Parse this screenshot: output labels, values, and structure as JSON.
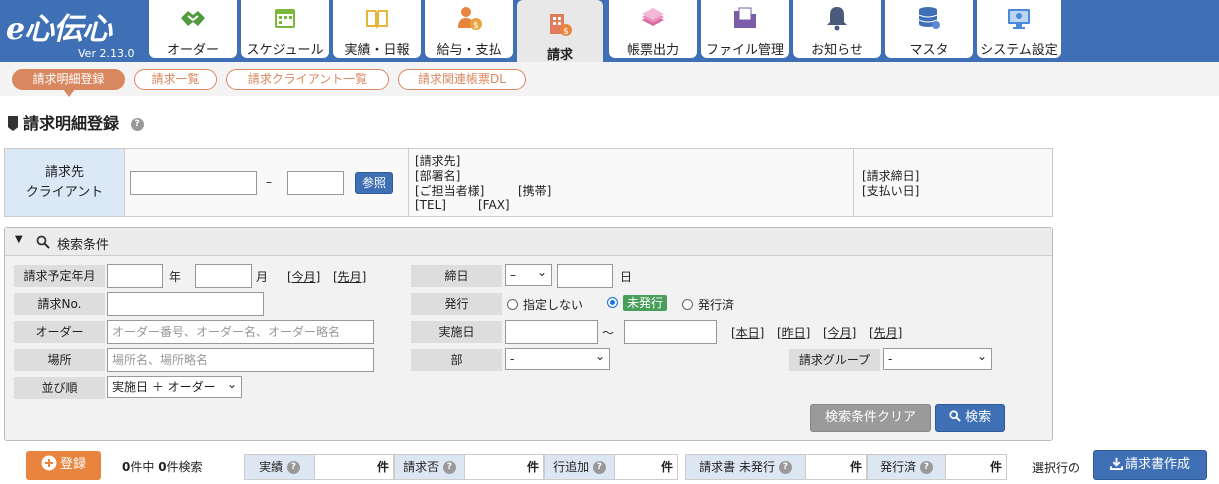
{
  "app": {
    "logo_text": "e心伝心",
    "version": "Ver 2.13.0"
  },
  "nav": {
    "tabs": [
      {
        "label": "オーダー",
        "icon": "handshake-icon"
      },
      {
        "label": "スケジュール",
        "icon": "calendar-icon"
      },
      {
        "label": "実績・日報",
        "icon": "book-icon"
      },
      {
        "label": "給与・支払",
        "icon": "payment-person-icon"
      },
      {
        "label": "請求",
        "icon": "billing-building-icon"
      },
      {
        "label": "帳票出力",
        "icon": "documents-icon"
      },
      {
        "label": "ファイル管理",
        "icon": "folder-icon"
      },
      {
        "label": "お知らせ",
        "icon": "bell-icon"
      },
      {
        "label": "マスタ",
        "icon": "database-icon"
      },
      {
        "label": "システム設定",
        "icon": "settings-monitor-icon"
      }
    ],
    "active": "請求"
  },
  "subnav": {
    "items": [
      "請求明細登録",
      "請求一覧",
      "請求クライアント一覧",
      "請求関連帳票DL"
    ],
    "active": "請求明細登録"
  },
  "page": {
    "title": "請求明細登録"
  },
  "client": {
    "header_line1": "請求先",
    "header_line2": "クライアント",
    "dash": "–",
    "ref_button": "参照",
    "info": [
      "[請求先]",
      "[部署名]",
      "[ご担当者様]",
      "[携帯]",
      "[TEL]",
      "[FAX]"
    ],
    "date_info": [
      "[請求締日]",
      "[支払い日]"
    ]
  },
  "search": {
    "header": "検索条件",
    "labels": {
      "year_month": "請求予定年月",
      "billing_no": "請求No.",
      "order": "オーダー",
      "place": "場所",
      "sort": "並び順",
      "closing": "締日",
      "issue": "発行",
      "exec_date": "実施日",
      "dept": "部",
      "group": "請求グループ"
    },
    "year_suffix": "年",
    "month_suffix": "月",
    "day_suffix": "日",
    "tilde": "～",
    "links_month": [
      "[今月]",
      "[先月]"
    ],
    "links_day": [
      "[本日]",
      "[昨日]",
      "[今月]",
      "[先月]"
    ],
    "order_placeholder": "オーダー番号、オーダー名、オーダー略名",
    "place_placeholder": "場所名、場所略名",
    "sort_value": "実施日 ＋ オーダー",
    "closing_value": "–",
    "dept_value": "-",
    "group_value": "-",
    "issue_options": [
      "指定しない",
      "未発行",
      "発行済"
    ],
    "issue_selected": "未発行",
    "clear_button": "検索条件クリア",
    "search_button": "検索"
  },
  "footer": {
    "register_button": "登録",
    "count_text_a": "0",
    "count_text_b": "件中 ",
    "count_text_c": "0",
    "count_text_d": "件検索",
    "stats": [
      {
        "label": "実績",
        "unit": "件"
      },
      {
        "label": "請求否",
        "unit": "件"
      },
      {
        "label": "行追加",
        "unit": "件"
      },
      {
        "label": "請求書 未発行",
        "unit": "件"
      },
      {
        "label": "発行済",
        "unit": "件"
      }
    ],
    "selected_label": "選択行の",
    "invoice_button": "請求書作成"
  },
  "colors": {
    "brand": "#3f6fb5",
    "accent": "#d9875e",
    "orange": "#e8843e",
    "green": "#4a9e5c"
  }
}
